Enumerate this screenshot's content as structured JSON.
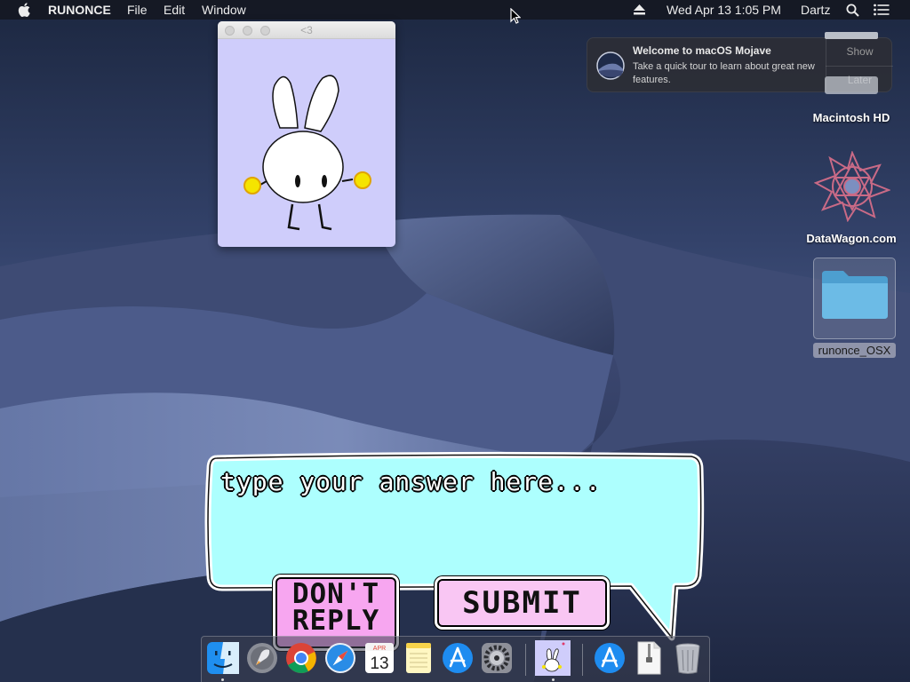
{
  "menubar": {
    "app_name": "RUNONCE",
    "menus": [
      "File",
      "Edit",
      "Window"
    ],
    "datetime": "Wed Apr 13  1:05 PM",
    "user": "Dartz",
    "icons": [
      "apple-icon",
      "eject-icon",
      "search-icon",
      "notification-center-icon"
    ]
  },
  "notification": {
    "title": "Welcome to macOS Mojave",
    "body": "Take a quick tour to learn about great new features.",
    "show_label": "Show",
    "later_label": "Later"
  },
  "bunny_window": {
    "title": "<3"
  },
  "desktop": {
    "items": [
      {
        "label": "Macintosh HD",
        "icon": "hard-drive-icon"
      },
      {
        "label": "DataWagon.com",
        "icon": "datawagon-logo-icon"
      },
      {
        "label": "runonce_OSX",
        "icon": "folder-icon"
      }
    ]
  },
  "prompt": {
    "placeholder": "type your answer here...",
    "dont_reply_label": "DON'T REPLY",
    "submit_label": "SUBMIT"
  },
  "dock": {
    "apps": [
      "finder-icon",
      "launchpad-icon",
      "chrome-icon",
      "safari-icon",
      "calendar-icon",
      "notes-icon",
      "app-store-icon",
      "system-preferences-icon",
      "runonce-app-icon",
      "app-store-downloads-icon",
      "zip-archive-icon",
      "trash-icon"
    ],
    "calendar_month": "APR",
    "calendar_day": "13"
  },
  "colors": {
    "bubble_fill": "#adfffe",
    "button_pink": "#f9c6f3",
    "bunny_bg": "#cfcdfb",
    "cheek_yellow": "#f5e400"
  }
}
